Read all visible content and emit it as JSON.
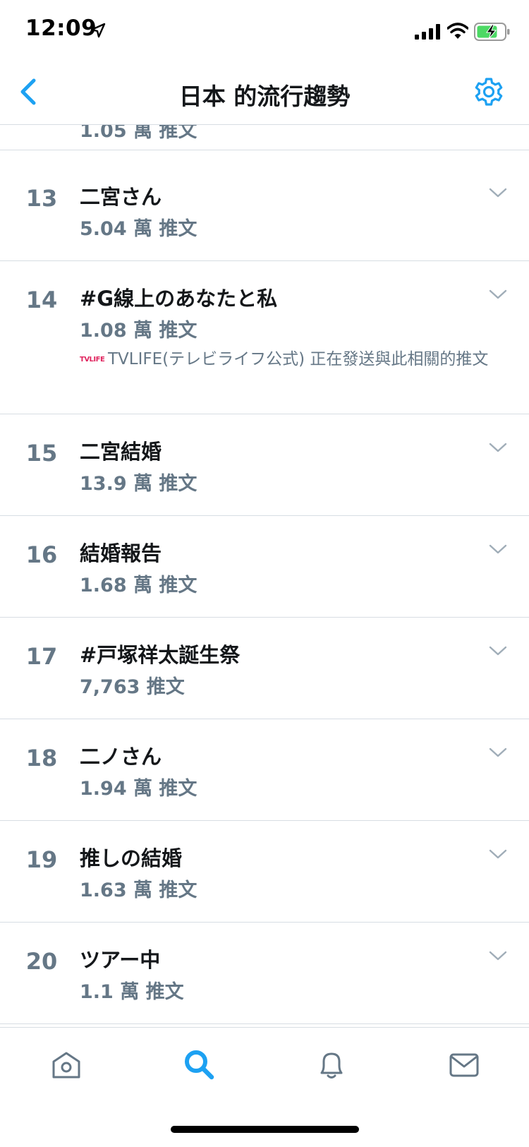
{
  "status_bar": {
    "time": "12:09",
    "location_icon": "location-arrow-icon",
    "signal_icon": "cellular-signal-icon",
    "wifi_icon": "wifi-icon",
    "battery_icon": "battery-charging-icon",
    "battery_color": "#4cd964"
  },
  "header": {
    "title": "日本 的流行趨勢",
    "back_icon": "chevron-left-icon",
    "settings_icon": "gear-icon",
    "accent_color": "#1da1f2"
  },
  "partial_row": {
    "count": "1.05 萬 推文"
  },
  "trends": [
    {
      "rank": "13",
      "name": "二宮さん",
      "count": "5.04 萬 推文"
    },
    {
      "rank": "14",
      "name": "#G線上のあなたと私",
      "count": "1.08 萬 推文",
      "meta": {
        "logo_text": "TVLIFE",
        "text": "TVLIFE(テレビライフ公式) 正在發送與此相關的推文"
      }
    },
    {
      "rank": "15",
      "name": "二宮結婚",
      "count": "13.9 萬 推文"
    },
    {
      "rank": "16",
      "name": "結婚報告",
      "count": "1.68 萬 推文"
    },
    {
      "rank": "17",
      "name": "#戸塚祥太誕生祭",
      "count": "7,763 推文"
    },
    {
      "rank": "18",
      "name": "二ノさん",
      "count": "1.94 萬 推文"
    },
    {
      "rank": "19",
      "name": "推しの結婚",
      "count": "1.63 萬 推文"
    },
    {
      "rank": "20",
      "name": "ツアー中",
      "count": "1.1 萬 推文"
    }
  ],
  "tab_bar": {
    "tabs": [
      {
        "icon": "home-icon",
        "active": false
      },
      {
        "icon": "search-icon",
        "active": true
      },
      {
        "icon": "bell-icon",
        "active": false
      },
      {
        "icon": "envelope-icon",
        "active": false
      }
    ]
  }
}
